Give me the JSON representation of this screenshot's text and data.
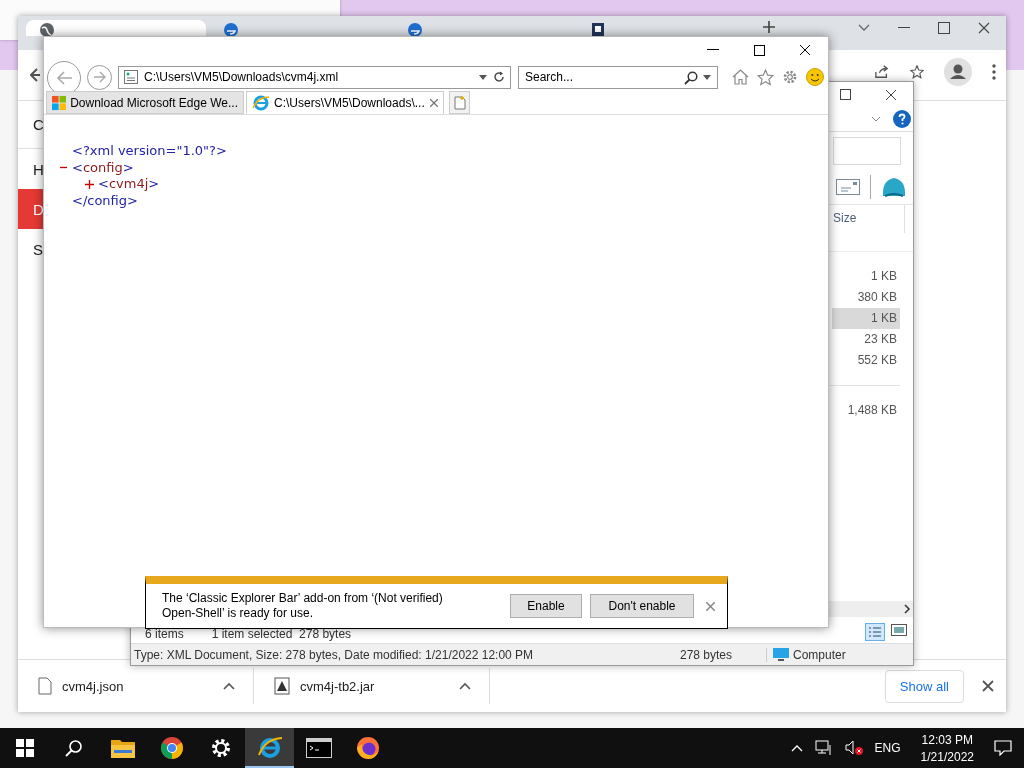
{
  "chrome": {
    "tabs": [
      {
        "kind": "globe",
        "selected": true
      },
      {
        "kind": "edge",
        "selected": false
      },
      {
        "kind": "edge",
        "selected": false
      },
      {
        "kind": "document",
        "selected": false
      }
    ],
    "sidebar_items": [
      {
        "label": "C",
        "selected": false
      },
      {
        "label": "H",
        "selected": false
      },
      {
        "label": "D",
        "selected": true
      },
      {
        "label": "S",
        "selected": false
      }
    ],
    "downloads": [
      {
        "kind": "file",
        "filename": "cvm4j.json"
      },
      {
        "kind": "jar",
        "filename": "cvm4j-tb2.jar"
      }
    ],
    "show_all": "Show all"
  },
  "explorer": {
    "column_header": "Size",
    "groups": [
      {
        "files": [
          {
            "size": "1 KB",
            "selected": false
          },
          {
            "size": "380 KB",
            "selected": false
          },
          {
            "size": "1 KB",
            "selected": true
          },
          {
            "size": "23 KB",
            "selected": false
          },
          {
            "size": "552 KB",
            "selected": false
          }
        ]
      },
      {
        "files": [
          {
            "size": "1,488 KB",
            "selected": false
          }
        ]
      }
    ],
    "status_items": "6 items",
    "status_selection": "1 item selected  278 bytes",
    "details": "Type: XML Document, Size: 278 bytes, Date modified: 1/21/2022 12:00 PM",
    "details_size": "278 bytes",
    "zone": "Computer"
  },
  "ie": {
    "address": "C:\\Users\\VM5\\Downloads\\cvm4j.xml",
    "search": {
      "placeholder": "Search..."
    },
    "tabs": [
      {
        "kind": "windows",
        "label": "Download Microsoft Edge We...",
        "selected": false
      },
      {
        "kind": "ie",
        "label": "C:\\Users\\VM5\\Downloads\\...",
        "selected": true
      }
    ],
    "document": [
      {
        "kind": "declaration",
        "text": "<?xml version=\"1.0\"?>"
      },
      {
        "kind": "element",
        "open_tag": "<config>",
        "close_tag": "</config>",
        "expanded": true,
        "children": [
          {
            "kind": "element",
            "open_tag": "<cvm4j>",
            "expanded": false
          }
        ]
      }
    ],
    "notification": {
      "message": "The ‘Classic Explorer Bar’ add-on from ‘(Not verified) Open-Shell’ is ready for use.",
      "buttons": [
        "Enable",
        "Don't enable"
      ]
    }
  },
  "taskbar": {
    "apps": [
      {
        "kind": "folder",
        "active": false
      },
      {
        "kind": "chrome",
        "active": false
      },
      {
        "kind": "settings",
        "active": false
      },
      {
        "kind": "ie",
        "active": true
      },
      {
        "kind": "terminal",
        "active": false
      },
      {
        "kind": "firefox",
        "active": false
      }
    ],
    "language": "ENG",
    "time": "12:03 PM",
    "date": "1/21/2022"
  }
}
